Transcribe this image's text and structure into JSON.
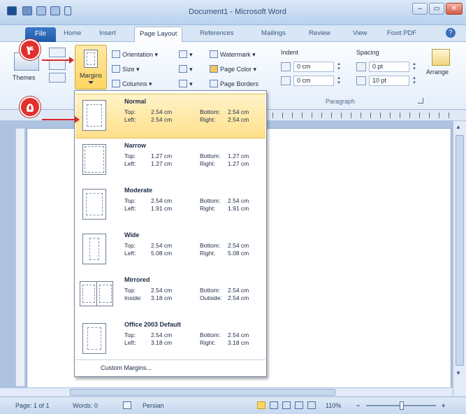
{
  "window": {
    "title": "Document1 - Microsoft Word",
    "minimize": "–",
    "maximize": "▭",
    "close": "✕"
  },
  "tabs": {
    "file": "File",
    "items": [
      "Home",
      "Insert",
      "Page Layout",
      "References",
      "Mailings",
      "Review",
      "View",
      "Foxit PDF"
    ],
    "active": "Page Layout",
    "help": "?"
  },
  "ribbon": {
    "themes": {
      "label": "Themes"
    },
    "margins": {
      "label": "Margins"
    },
    "orientation": "Orientation",
    "size": "Size",
    "columns": "Columns",
    "watermark": "Watermark",
    "page_color": "Page Color",
    "page_borders": "Page Borders",
    "indent": {
      "title": "Indent",
      "left": "0 cm",
      "right": "0 cm"
    },
    "spacing": {
      "title": "Spacing",
      "before": "0 pt",
      "after": "10 pt"
    },
    "paragraph_group": "Paragraph",
    "arrange": "Arrange"
  },
  "callouts": {
    "four": "۴",
    "five": "۵"
  },
  "margin_options": [
    {
      "name": "Normal",
      "label_a": "Top:",
      "val_a": "2.54 cm",
      "label_b": "Bottom:",
      "val_b": "2.54 cm",
      "label_c": "Left:",
      "val_c": "2.54 cm",
      "label_d": "Right:",
      "val_d": "2.54 cm",
      "selected": true
    },
    {
      "name": "Narrow",
      "label_a": "Top:",
      "val_a": "1.27 cm",
      "label_b": "Bottom:",
      "val_b": "1.27 cm",
      "label_c": "Left:",
      "val_c": "1.27 cm",
      "label_d": "Right:",
      "val_d": "1.27 cm"
    },
    {
      "name": "Moderate",
      "label_a": "Top:",
      "val_a": "2.54 cm",
      "label_b": "Bottom:",
      "val_b": "2.54 cm",
      "label_c": "Left:",
      "val_c": "1.91 cm",
      "label_d": "Right:",
      "val_d": "1.91 cm"
    },
    {
      "name": "Wide",
      "label_a": "Top:",
      "val_a": "2.54 cm",
      "label_b": "Bottom:",
      "val_b": "2.54 cm",
      "label_c": "Left:",
      "val_c": "5.08 cm",
      "label_d": "Right:",
      "val_d": "5.08 cm"
    },
    {
      "name": "Mirrored",
      "label_a": "Top:",
      "val_a": "2.54 cm",
      "label_b": "Bottom:",
      "val_b": "2.54 cm",
      "label_c": "Inside:",
      "val_c": "3.18 cm",
      "label_d": "Outside:",
      "val_d": "2.54 cm"
    },
    {
      "name": "Office 2003 Default",
      "label_a": "Top:",
      "val_a": "2.54 cm",
      "label_b": "Bottom:",
      "val_b": "2.54 cm",
      "label_c": "Left:",
      "val_c": "3.18 cm",
      "label_d": "Right:",
      "val_d": "3.18 cm"
    }
  ],
  "custom_margins": "Custom Margins...",
  "status": {
    "page": "Page: 1 of 1",
    "words": "Words: 0",
    "language": "Persian",
    "zoom": "110%",
    "zoom_out": "−",
    "zoom_in": "+"
  },
  "colors": {
    "file_tab": "#2a68b6",
    "selected_option": "#ffe08a",
    "callout": "#e0312d"
  }
}
